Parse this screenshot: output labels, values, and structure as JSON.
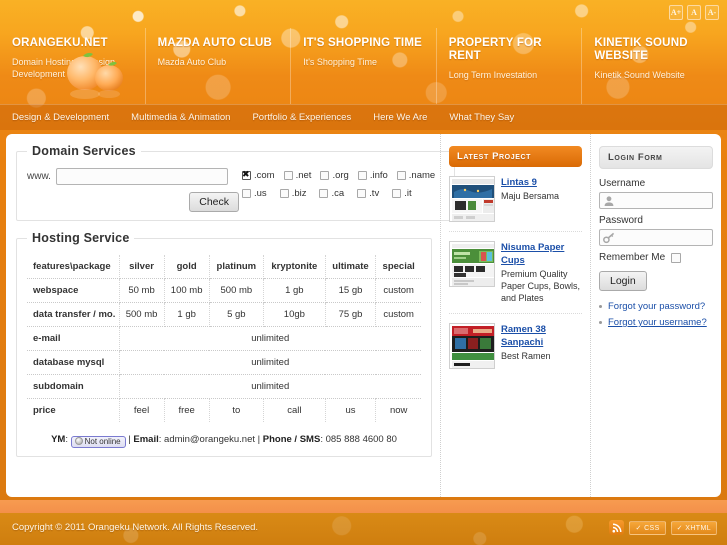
{
  "topbar": {
    "font_buttons": [
      {
        "label": "A+",
        "name": "font-increase"
      },
      {
        "label": "A",
        "name": "font-reset"
      },
      {
        "label": "A-",
        "name": "font-decrease"
      }
    ]
  },
  "header": {
    "panels": [
      {
        "title": "ORANGEKU.NET",
        "sub": "Domain Hosting & Design Development Services"
      },
      {
        "title": "MAZDA AUTO CLUB",
        "sub": "Mazda Auto Club"
      },
      {
        "title": "IT'S SHOPPING TIME",
        "sub": "It's Shopping Time"
      },
      {
        "title": "PROPERTY FOR RENT",
        "sub": "Long Term Investation"
      },
      {
        "title": "KINETIK SOUND WEBSITE",
        "sub": "Kinetik Sound Website"
      }
    ]
  },
  "nav": {
    "items": [
      "Design & Development",
      "Multimedia & Animation",
      "Portfolio & Experiences",
      "Here We Are",
      "What They Say"
    ]
  },
  "domain_services": {
    "legend": "Domain Services",
    "www_label": "www.",
    "input_value": "",
    "input_placeholder": "",
    "check_label": "Check",
    "tlds_row1": [
      {
        "label": ".com",
        "checked": true
      },
      {
        "label": ".net",
        "checked": false
      },
      {
        "label": ".org",
        "checked": false
      },
      {
        "label": ".info",
        "checked": false
      },
      {
        "label": ".name",
        "checked": false
      }
    ],
    "tlds_row2": [
      {
        "label": ".us",
        "checked": false
      },
      {
        "label": ".biz",
        "checked": false
      },
      {
        "label": ".ca",
        "checked": false
      },
      {
        "label": ".tv",
        "checked": false
      },
      {
        "label": ".it",
        "checked": false
      }
    ]
  },
  "hosting_service": {
    "legend": "Hosting Service",
    "columns": [
      "features\\package",
      "silver",
      "gold",
      "platinum",
      "kryptonite",
      "ultimate",
      "special"
    ],
    "rows": [
      {
        "feature": "webspace",
        "cells": [
          "50 mb",
          "100 mb",
          "500 mb",
          "1 gb",
          "15 gb",
          "custom"
        ],
        "span": false
      },
      {
        "feature": "data transfer / mo.",
        "cells": [
          "500 mb",
          "1 gb",
          "5 gb",
          "10gb",
          "75 gb",
          "custom"
        ],
        "span": false
      },
      {
        "feature": "e-mail",
        "cells": [
          "unlimited"
        ],
        "span": true
      },
      {
        "feature": "database mysql",
        "cells": [
          "unlimited"
        ],
        "span": true
      },
      {
        "feature": "subdomain",
        "cells": [
          "unlimited"
        ],
        "span": true
      },
      {
        "feature": "price",
        "cells": [
          "feel",
          "free",
          "to",
          "call",
          "us",
          "now"
        ],
        "span": false
      }
    ]
  },
  "contact": {
    "ym_label": "YM",
    "ym_status": "Not online",
    "sep1": "|",
    "email_label": "Email",
    "email_value": "admin@orangeku.net",
    "sep2": "|",
    "phone_label": "Phone / SMS",
    "phone_value": "085 888 4600 80",
    "colon": ":"
  },
  "latest_project": {
    "heading": "Latest Project",
    "items": [
      {
        "title": "Lintas 9",
        "desc": "Maju Bersama",
        "thumb_theme": "blue"
      },
      {
        "title": "Nisuma Paper Cups",
        "desc": "Premium Quality Paper Cups, Bowls, and Plates",
        "thumb_theme": "green"
      },
      {
        "title": "Ramen 38 Sanpachi",
        "desc": "Best Ramen",
        "thumb_theme": "red"
      }
    ]
  },
  "login_form": {
    "heading": "Login Form",
    "username_label": "Username",
    "username_value": "",
    "password_label": "Password",
    "password_value": "",
    "remember_label": "Remember Me",
    "remember_checked": false,
    "login_button": "Login",
    "links": [
      {
        "label": "Forgot your password?",
        "underline": false
      },
      {
        "label": "Forgot your username?",
        "underline": true
      }
    ]
  },
  "footer": {
    "copyright": "Copyright © 2011 Orangeku Network. All Rights Reserved.",
    "badges": [
      {
        "label": "✓ CSS"
      },
      {
        "label": "✓ XHTML"
      }
    ],
    "rss_name": "rss-icon"
  },
  "colors": {
    "brand_orange": "#e8800f",
    "panel_head": "#d96a05",
    "link_blue": "#1b4fa8"
  }
}
